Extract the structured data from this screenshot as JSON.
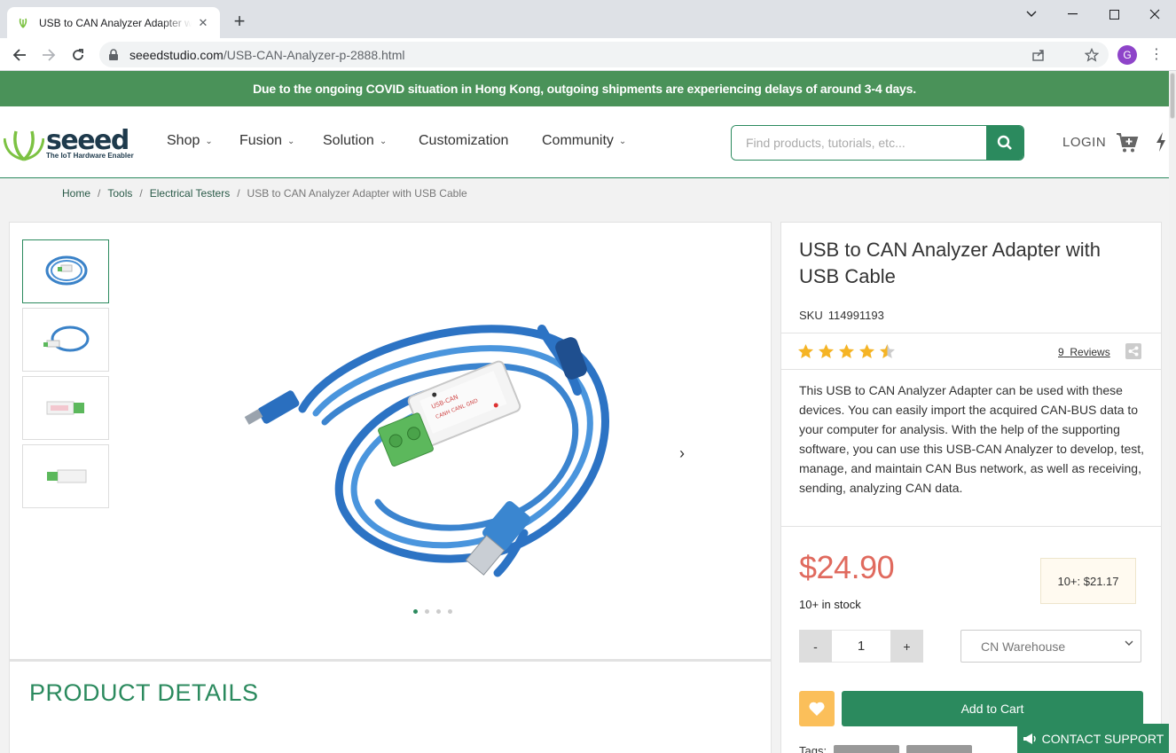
{
  "browser": {
    "tab_title": "USB to CAN Analyzer Adapter with USB Cable",
    "new_tab": "+",
    "url_host": "seeedstudio.com",
    "url_path": "/USB-CAN-Analyzer-p-2888.html",
    "profile_initial": "G"
  },
  "banner": {
    "text": "Due to the ongoing COVID situation in Hong Kong, outgoing shipments are experiencing delays of around 3-4 days."
  },
  "header": {
    "logo_word": "seeed",
    "logo_tagline": "The IoT Hardware Enabler",
    "nav": [
      "Shop",
      "Fusion",
      "Solution",
      "Customization",
      "Community"
    ],
    "search_placeholder": "Find products, tutorials, etc...",
    "login": "LOGIN"
  },
  "breadcrumb": [
    "Home",
    "Tools",
    "Electrical Testers",
    "USB to CAN Analyzer Adapter with USB Cable"
  ],
  "gallery": {
    "dots_count": 4,
    "active_dot": 1
  },
  "product": {
    "title": "USB to CAN Analyzer Adapter with USB Cable",
    "sku_label": "SKU",
    "sku": "114991193",
    "rating": 4.5,
    "reviews_count": "9",
    "reviews_label": "Reviews",
    "description": "This USB to CAN Analyzer Adapter can be used with these devices. You can easily import the acquired CAN-BUS data to your computer for analysis. With the help of the supporting software, you can use this USB-CAN Analyzer to develop, test, manage, and maintain CAN Bus network, as well as receiving, sending, analyzing CAN data.",
    "price": "$24.90",
    "tier_price": "10+: $21.17",
    "stock": "10+ in stock",
    "qty_minus": "-",
    "qty_value": "1",
    "qty_plus": "+",
    "warehouse": "CN Warehouse",
    "add_to_cart": "Add to Cart",
    "tags_label": "Tags:"
  },
  "details_heading": "PRODUCT DETAILS",
  "support": "CONTACT SUPPORT",
  "colors": {
    "brand_green": "#2b8a5e",
    "banner_green": "#4a9259",
    "price_red": "#e06a5e",
    "wish_orange": "#fbbf5a"
  }
}
